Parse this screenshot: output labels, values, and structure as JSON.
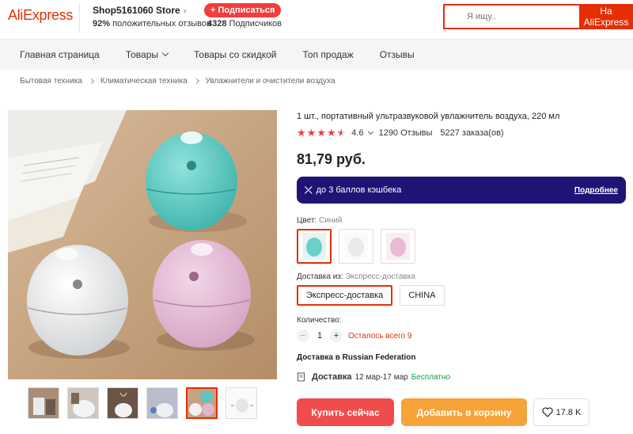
{
  "header": {
    "logo": "AliExpress",
    "store_name": "Shop5161060 Store",
    "store_caret": "▾",
    "positive_pct": "92%",
    "positive_label": " положительных отзывов",
    "subscribe_label": "+ Подписаться",
    "subscribers_count": "4328",
    "subscribers_label": " Подписчиков",
    "search_placeholder": "Я ищу..",
    "search_button": "На AliExpress"
  },
  "nav": {
    "items": [
      "Главная страница",
      "Товары",
      "Товары со скидкой",
      "Топ продаж",
      "Отзывы"
    ]
  },
  "breadcrumb": [
    "Бытовая техника",
    "Климатическая техника",
    "Увлажнители и очистители воздуха"
  ],
  "product": {
    "title": "1 шт., портативный ультразвуковой увлажнитель воздуха, 220 мл",
    "rating": "4.6",
    "rating_stars": 4.6,
    "reviews": "1290 Отзывы",
    "orders": "5227 заказа(ов)",
    "price": "81,79 руб.",
    "cashback_text": "до 3 баллов кэшбека",
    "cashback_link": "Подробнее",
    "color_label": "Цвет: ",
    "color_value": "Синий",
    "ship_from_label": "Доставка из: ",
    "ship_from_value": "Экспресс-доставка",
    "ship_options": [
      "Экспресс-доставка",
      "CHINA"
    ],
    "qty_label": "Количество:",
    "qty_minus": "−",
    "qty_value": "1",
    "qty_plus": "+",
    "qty_left": "Осталось всего 9",
    "delivery_to": "Доставка в Russian Federation",
    "delivery_label": "Доставка",
    "delivery_dates": "12 мар-17 мар",
    "delivery_price": "Бесплатно",
    "buy_now": "Купить сейчас",
    "add_to_cart": "Добавить в корзину",
    "wishlist_count": "17.8 K"
  },
  "colors": {
    "accent": "#e62e04",
    "cashback_bg": "#1f1475",
    "buy_button": "#f04c4c",
    "cart_button": "#f6a33a",
    "free_green": "#0a9d4c"
  }
}
